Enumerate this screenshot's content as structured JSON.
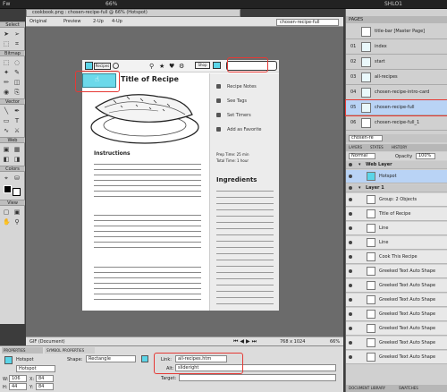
{
  "app": {
    "title": "Fw",
    "zoom": "66%",
    "user": "SHLO1"
  },
  "document": {
    "tab_title": "cookbook.png : chosen-recipe-full @ 66% (Hotspot)"
  },
  "view": {
    "original": "Original",
    "preview": "Preview",
    "twoup": "2-Up",
    "fourup": "4-Up",
    "page_select": "chosen-recipe-full"
  },
  "tools": {
    "select": "Select",
    "bitmap": "Bitmap",
    "vector": "Vector",
    "web": "Web",
    "colors": "Colors",
    "view": "View"
  },
  "canvas": {
    "nav_label": "Recipes",
    "shop_label": "Shop",
    "title": "Title of Recipe",
    "instructions_title": "Instructions",
    "ingredients_title": "Ingredients",
    "links": [
      "Recipe Notes",
      "See Tags",
      "Set Timers",
      "Add as Favorite"
    ],
    "prep_time": "Prep Time: 25 min",
    "total_time": "Total Time: 1 hour"
  },
  "status": {
    "doc_label": "GIF (Document)",
    "size": "768 x 1024",
    "zoom": "66%"
  },
  "properties": {
    "tab1": "PROPERTIES",
    "tab2": "SYMBOL PROPERTIES",
    "name_label": "Hotspot",
    "name_value": "Hotspot",
    "shape_label": "Shape:",
    "shape_value": "Rectangle",
    "link_label": "Link:",
    "link_value": "all-recipes.htm",
    "alt_label": "Alt:",
    "alt_value": "slideright",
    "target_label": "Target:",
    "w": "106",
    "h": "44",
    "x": "84",
    "y": "84"
  },
  "pages_panel": {
    "header": "PAGES",
    "pages": [
      {
        "num": "",
        "name": "title-bar [Master Page]"
      },
      {
        "num": "01",
        "name": "index"
      },
      {
        "num": "02",
        "name": "start"
      },
      {
        "num": "03",
        "name": "all-recipes"
      },
      {
        "num": "04",
        "name": "chosen-recipe-intro-card"
      },
      {
        "num": "05",
        "name": "chosen-recipe-full"
      },
      {
        "num": "06",
        "name": "chosen-recipe-full_1"
      }
    ],
    "selected": "chosen-re"
  },
  "layers_panel": {
    "tabs": [
      "LAYERS",
      "STATES",
      "HISTORY"
    ],
    "blend": "Normal",
    "opacity_label": "Opacity",
    "opacity": "100%",
    "layers": [
      {
        "name": "Web Layer",
        "kind": "folder"
      },
      {
        "name": "Hotspot",
        "kind": "item",
        "selected": true
      },
      {
        "name": "Layer 1",
        "kind": "folder"
      },
      {
        "name": "Group: 2 Objects",
        "kind": "item"
      },
      {
        "name": "Title of Recipe",
        "kind": "item"
      },
      {
        "name": "Line",
        "kind": "item"
      },
      {
        "name": "Line",
        "kind": "item"
      },
      {
        "name": "Cook This Recipe",
        "kind": "item"
      },
      {
        "name": "Greeked Text Auto Shape",
        "kind": "item"
      },
      {
        "name": "Greeked Text Auto Shape",
        "kind": "item"
      },
      {
        "name": "Greeked Text Auto Shape",
        "kind": "item"
      },
      {
        "name": "Greeked Text Auto Shape",
        "kind": "item"
      },
      {
        "name": "Greeked Text Auto Shape",
        "kind": "item"
      },
      {
        "name": "Greeked Text Auto Shape",
        "kind": "item"
      },
      {
        "name": "Greeked Text Auto Shape",
        "kind": "item"
      }
    ],
    "bottom_tabs": [
      "DOCUMENT LIBRARY",
      "SWATCHES"
    ]
  },
  "colors": {
    "accent": "#5bd5e8",
    "selection": "#e53935",
    "selected_row": "#b9d3f5"
  }
}
